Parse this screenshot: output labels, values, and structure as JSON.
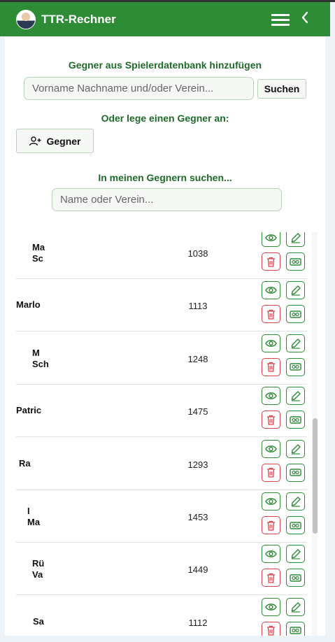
{
  "header": {
    "app_title": "TTR-Rechner"
  },
  "search_db": {
    "title": "Gegner aus Spielerdatenbank hinzufügen",
    "placeholder": "Vorname Nachname und/oder Verein...",
    "value": "",
    "button_label": "Suchen"
  },
  "create": {
    "title": "Oder lege einen Gegner an:",
    "button_label": "Gegner"
  },
  "filter": {
    "title": "In meinen Gegnern suchen...",
    "placeholder": "Name oder Verein...",
    "value": ""
  },
  "opponents": [
    {
      "name_line1": "Ma",
      "name_line2": "Sc",
      "ttr": "1038"
    },
    {
      "name_line1": "Marlo",
      "name_line2": "",
      "ttr": "1113"
    },
    {
      "name_line1": "M",
      "name_line2": "Sch",
      "ttr": "1248"
    },
    {
      "name_line1": "Patric",
      "name_line2": "",
      "ttr": "1475"
    },
    {
      "name_line1": "Ra",
      "name_line2": "",
      "ttr": "1293"
    },
    {
      "name_line1": "I",
      "name_line2": "Ma",
      "ttr": "1453"
    },
    {
      "name_line1": "Rü",
      "name_line2": "Va",
      "ttr": "1449"
    },
    {
      "name_line1": "Sa",
      "name_line2": "",
      "ttr": "1112"
    }
  ],
  "colors": {
    "header_bg": "#2e8b36",
    "title_green": "#1f6b2a",
    "action_green": "#2e8b36",
    "delete_red": "#d8434a"
  },
  "icons": {
    "view": "eye-icon",
    "edit": "pencil-icon",
    "delete": "trash-icon",
    "money": "money-icon",
    "add_user": "user-plus-icon",
    "menu": "hamburger-icon",
    "back": "chevron-left-icon"
  }
}
